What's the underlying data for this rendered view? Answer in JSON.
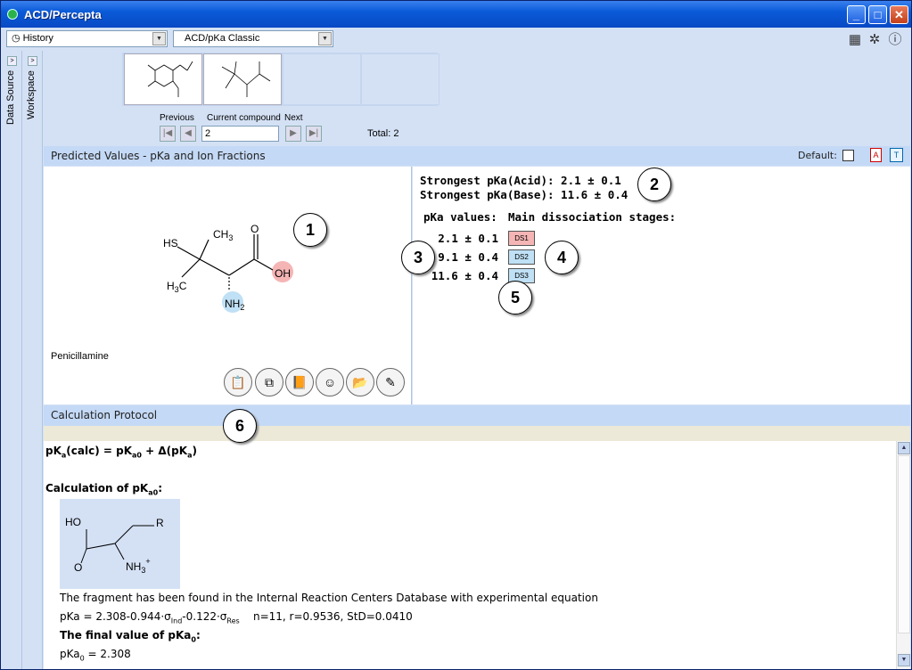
{
  "window": {
    "title": "ACD/Percepta",
    "minimize": "_",
    "maximize": "□",
    "close": "✕"
  },
  "toolbar": {
    "history_label": "History",
    "module_label": "ACD/pKa Classic",
    "icons": [
      "calculator-icon",
      "gear-icon",
      "info-icon"
    ]
  },
  "side_panels": {
    "data_source": "Data Source",
    "workspace": "Workspace"
  },
  "browser": {
    "previous_label": "Previous",
    "current_label": "Current compound",
    "next_label": "Next",
    "current_value": "2",
    "total": "Total: 2"
  },
  "predicted": {
    "header": "Predicted Values - pKa and Ion Fractions",
    "default_label": "Default:",
    "compound_name": "Penicillamine",
    "strongest_acid": "Strongest pKa(Acid): 2.1 ± 0.1",
    "strongest_base": "Strongest pKa(Base): 11.6 ± 0.4",
    "pka_header": "pKa values:",
    "stages_header": "Main dissociation stages:",
    "pka_values": [
      "2.1 ± 0.1",
      "9.1 ± 0.4",
      "11.6 ± 0.4"
    ],
    "stages": [
      "DS1",
      "DS2",
      "DS3"
    ],
    "stage_colors": [
      "#f5b5b5",
      "#bfe0f5",
      "#bfe0f5"
    ]
  },
  "molecule": {
    "hs": "HS",
    "ch3": "CH",
    "ch3_sub": "3",
    "h3c": "H",
    "h3c_sub": "3",
    "h3c_c": "C",
    "o": "O",
    "oh": "OH",
    "nh2": "NH",
    "nh2_sub": "2"
  },
  "callouts": [
    "1",
    "2",
    "3",
    "4",
    "5",
    "6"
  ],
  "protocol": {
    "header": "Calculation Protocol",
    "eq_main": "pK",
    "calculation_of": "Calculation of pK",
    "fragment_text": "The fragment has been found in the Internal Reaction Centers Database with experimental equation",
    "eq_pka": "pKa = 2.308-0.944·σ",
    "eq_ind": "Ind",
    "eq_mid": "-0.122·σ",
    "eq_res": "Res",
    "eq_stats": "n=11, r=0.9536, StD=0.0410",
    "final_value": "The final value of pKa",
    "result": "pKa",
    "result_val": " = 2.308",
    "frag_ho": "HO",
    "frag_r": "R",
    "frag_o": "O",
    "frag_nh3": "NH",
    "frag_nh3_sub": "3",
    "frag_plus": "+"
  },
  "colors": {
    "acid_highlight": "#f5b5b5",
    "base_highlight": "#bfe0f5",
    "header_bg": "#c4d9f5"
  }
}
